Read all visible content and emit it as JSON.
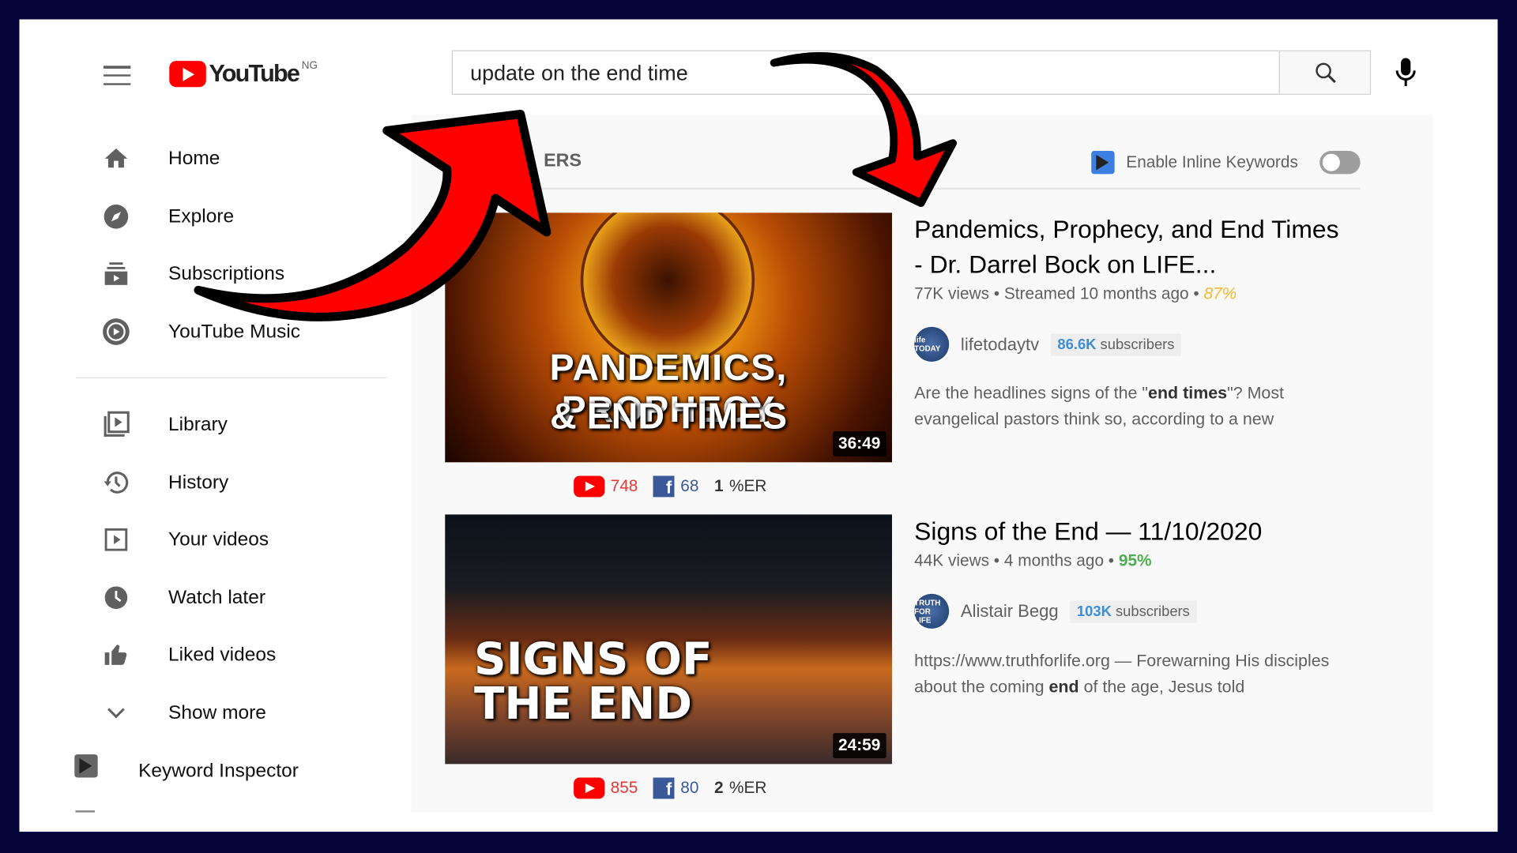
{
  "header": {
    "logo": "YouTube",
    "region": "NG",
    "search_value": "update on the end time",
    "search_icon": "search-icon",
    "mic_icon": "mic-icon"
  },
  "sidebar": {
    "items": [
      {
        "label": "Home",
        "icon": "home-icon"
      },
      {
        "label": "Explore",
        "icon": "compass-icon"
      },
      {
        "label": "Subscriptions",
        "icon": "subscriptions-icon"
      },
      {
        "label": "YouTube Music",
        "icon": "music-icon"
      },
      {
        "label": "Library",
        "icon": "library-icon"
      },
      {
        "label": "History",
        "icon": "history-icon"
      },
      {
        "label": "Your videos",
        "icon": "your-videos-icon"
      },
      {
        "label": "Watch later",
        "icon": "clock-icon"
      },
      {
        "label": "Liked videos",
        "icon": "thumbs-up-icon"
      },
      {
        "label": "Show more",
        "icon": "chevron-down-icon"
      }
    ],
    "keyword_inspector": "Keyword Inspector"
  },
  "results": {
    "header": "ERS",
    "inline_keywords": {
      "label": "Enable Inline Keywords",
      "enabled": false
    },
    "videos": [
      {
        "thumb_text1": "PANDEMICS, PROPHECY",
        "thumb_text2": "& END TIMES",
        "duration": "36:49",
        "title": "Pandemics, Prophecy, and End Times - Dr. Darrel Bock on LIFE...",
        "views": "77K views",
        "age": "Streamed 10 months ago",
        "score": "87%",
        "score_color": "#f5b82e",
        "channel": "lifetodaytv",
        "avatar_text": "life TODAY",
        "subs_count": "86.6K",
        "subs_label": "subscribers",
        "desc_pre": "Are the headlines signs of the \"",
        "desc_bold": "end times",
        "desc_post": "\"? Most evangelical pastors think so, according to a new",
        "yt_count": "748",
        "fb_count": "68",
        "er": "1",
        "er_label": "%ER"
      },
      {
        "thumb_text1": "SIGNS OF",
        "thumb_text2": "THE END",
        "duration": "24:59",
        "title": "Signs of the End — 11/10/2020",
        "views": "44K views",
        "age": "4 months ago",
        "score": "95%",
        "score_color": "#4caf50",
        "channel": "Alistair Begg",
        "avatar_text": "TRUTH FOR LIFE",
        "subs_count": "103K",
        "subs_label": "subscribers",
        "desc_pre": "https://www.truthforlife.org — Forewarning His disciples about the coming ",
        "desc_bold": "end",
        "desc_post": " of the age, Jesus told",
        "yt_count": "855",
        "fb_count": "80",
        "er": "2",
        "er_label": "%ER"
      }
    ]
  },
  "colors": {
    "frame": "#05053a",
    "accent": "#ff0000",
    "arrow": "#ff0000"
  }
}
